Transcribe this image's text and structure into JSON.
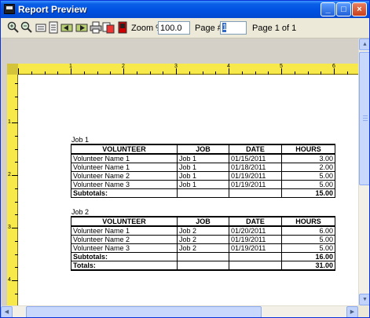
{
  "window": {
    "title": "Report Preview",
    "controls": {
      "minimize": "_",
      "maximize": "□",
      "close": "×"
    }
  },
  "toolbar": {
    "zoom_label": "Zoom %",
    "zoom_value": "100.0",
    "page_label": "Page #",
    "page_value": "1",
    "page_of": "Page 1 of 1",
    "icons": [
      "zoom-in-icon",
      "zoom-out-icon",
      "fit-page-icon",
      "single-page-icon",
      "previous-page-icon",
      "next-page-icon",
      "print-icon",
      "export-icon",
      "exit-icon"
    ]
  },
  "rulers": {
    "top": [
      "1",
      "2",
      "3",
      "4",
      "5",
      "6"
    ],
    "left": [
      "1",
      "2",
      "3",
      "4"
    ]
  },
  "report": {
    "columns": [
      "VOLUNTEER",
      "JOB",
      "DATE",
      "HOURS"
    ],
    "groups": [
      {
        "label": "Job 1",
        "rows": [
          [
            "Volunteer Name 1",
            "Job 1",
            "01/15/2011",
            "3.00"
          ],
          [
            "Volunteer Name 1",
            "Job 1",
            "01/18/2011",
            "2.00"
          ],
          [
            "Volunteer Name 2",
            "Job 1",
            "01/19/2011",
            "5.00"
          ],
          [
            "Volunteer Name 3",
            "Job 1",
            "01/19/2011",
            "5.00"
          ]
        ],
        "subtotal_label": "Subtotals:",
        "subtotal_value": "15.00"
      },
      {
        "label": "Job 2",
        "rows": [
          [
            "Volunteer Name 1",
            "Job 2",
            "01/20/2011",
            "6.00"
          ],
          [
            "Volunteer Name 2",
            "Job 2",
            "01/19/2011",
            "5.00"
          ],
          [
            "Volunteer Name 3",
            "Job 2",
            "01/19/2011",
            "5.00"
          ]
        ],
        "subtotal_label": "Subtotals:",
        "subtotal_value": "16.00",
        "total_label": "Totals:",
        "total_value": "31.00"
      }
    ]
  },
  "colors": {
    "titlebar": "#0050e0",
    "ruler": "#f7e94a",
    "chrome": "#ece9d8"
  }
}
